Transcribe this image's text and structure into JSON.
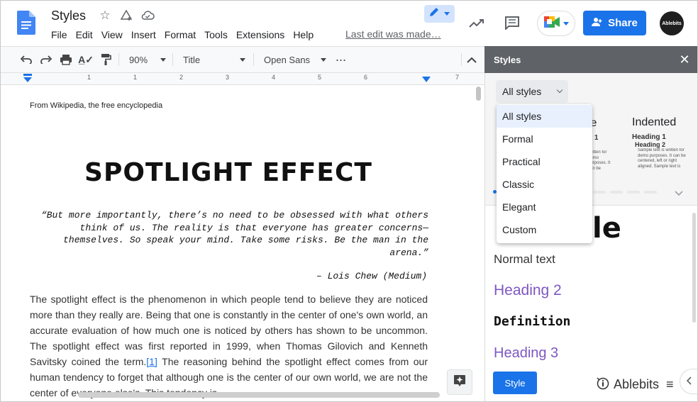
{
  "app": {
    "doc_title": "Styles",
    "menu": [
      "File",
      "Edit",
      "View",
      "Insert",
      "Format",
      "Tools",
      "Extensions",
      "Help"
    ],
    "last_edit": "Last edit was made…",
    "share_label": "Share",
    "avatar_text": "Ablebits"
  },
  "toolbar": {
    "zoom": "90%",
    "paragraph_style": "Title",
    "font": "Open Sans"
  },
  "ruler": {
    "numbers": [
      "1",
      "1",
      "2",
      "3",
      "4",
      "5",
      "6",
      "7"
    ]
  },
  "document": {
    "source_line": "From Wikipedia, the free encyclopedia",
    "heading": "SPOTLIGHT EFFECT",
    "quote": "“But more importantly, there’s no need to be obsessed with what others think of us. The reality is that everyone has greater concerns—themselves. So speak your mind. Take some risks. Be the man in the arena.”",
    "quote_author": "– Lois Chew (Medium)",
    "body_before_link": "The spotlight effect is the phenomenon in which people tend to believe they are noticed more than they really are. Being that one is constantly in the center of one's own world, an accurate evaluation of how much one is noticed by others has shown to be uncommon. The spotlight effect was first reported in 1999, when Thomas Gilovich and Kenneth Savitsky coined the term.",
    "link": "[1]",
    "body_after_link": " The reasoning behind the spotlight effect comes from our human tendency to forget that although one is the center of our own world, we are not the center of everyone else's. This tendency is"
  },
  "styles_panel": {
    "title": "Styles",
    "filter_selected": "All styles",
    "filter_options": [
      "All styles",
      "Formal",
      "Practical",
      "Classic",
      "Elegant",
      "Custom"
    ],
    "theme_partial_label": "le",
    "theme_indented": {
      "name": "Indented",
      "h1": "Heading 1",
      "h2": "Heading 2",
      "sample": "Sample text is written for demo purposes. It can be centered, left or right aligned. Sample text is written for demo"
    },
    "theme_partial": {
      "h1": "g 1",
      "h2": "2",
      "sample": "written for demo purposes. It can be centered, left or right aligned. Sample text is"
    },
    "samples": {
      "title_partial": "le",
      "normal": "Normal text",
      "heading2": "Heading 2",
      "definition": "Definition",
      "heading3": "Heading 3"
    },
    "style_button": "Style",
    "brand": "Ablebits",
    "colors": {
      "heading_purple": "#7e57c2",
      "accent_blue": "#1a73e8",
      "panel_header": "#5f6368"
    }
  }
}
